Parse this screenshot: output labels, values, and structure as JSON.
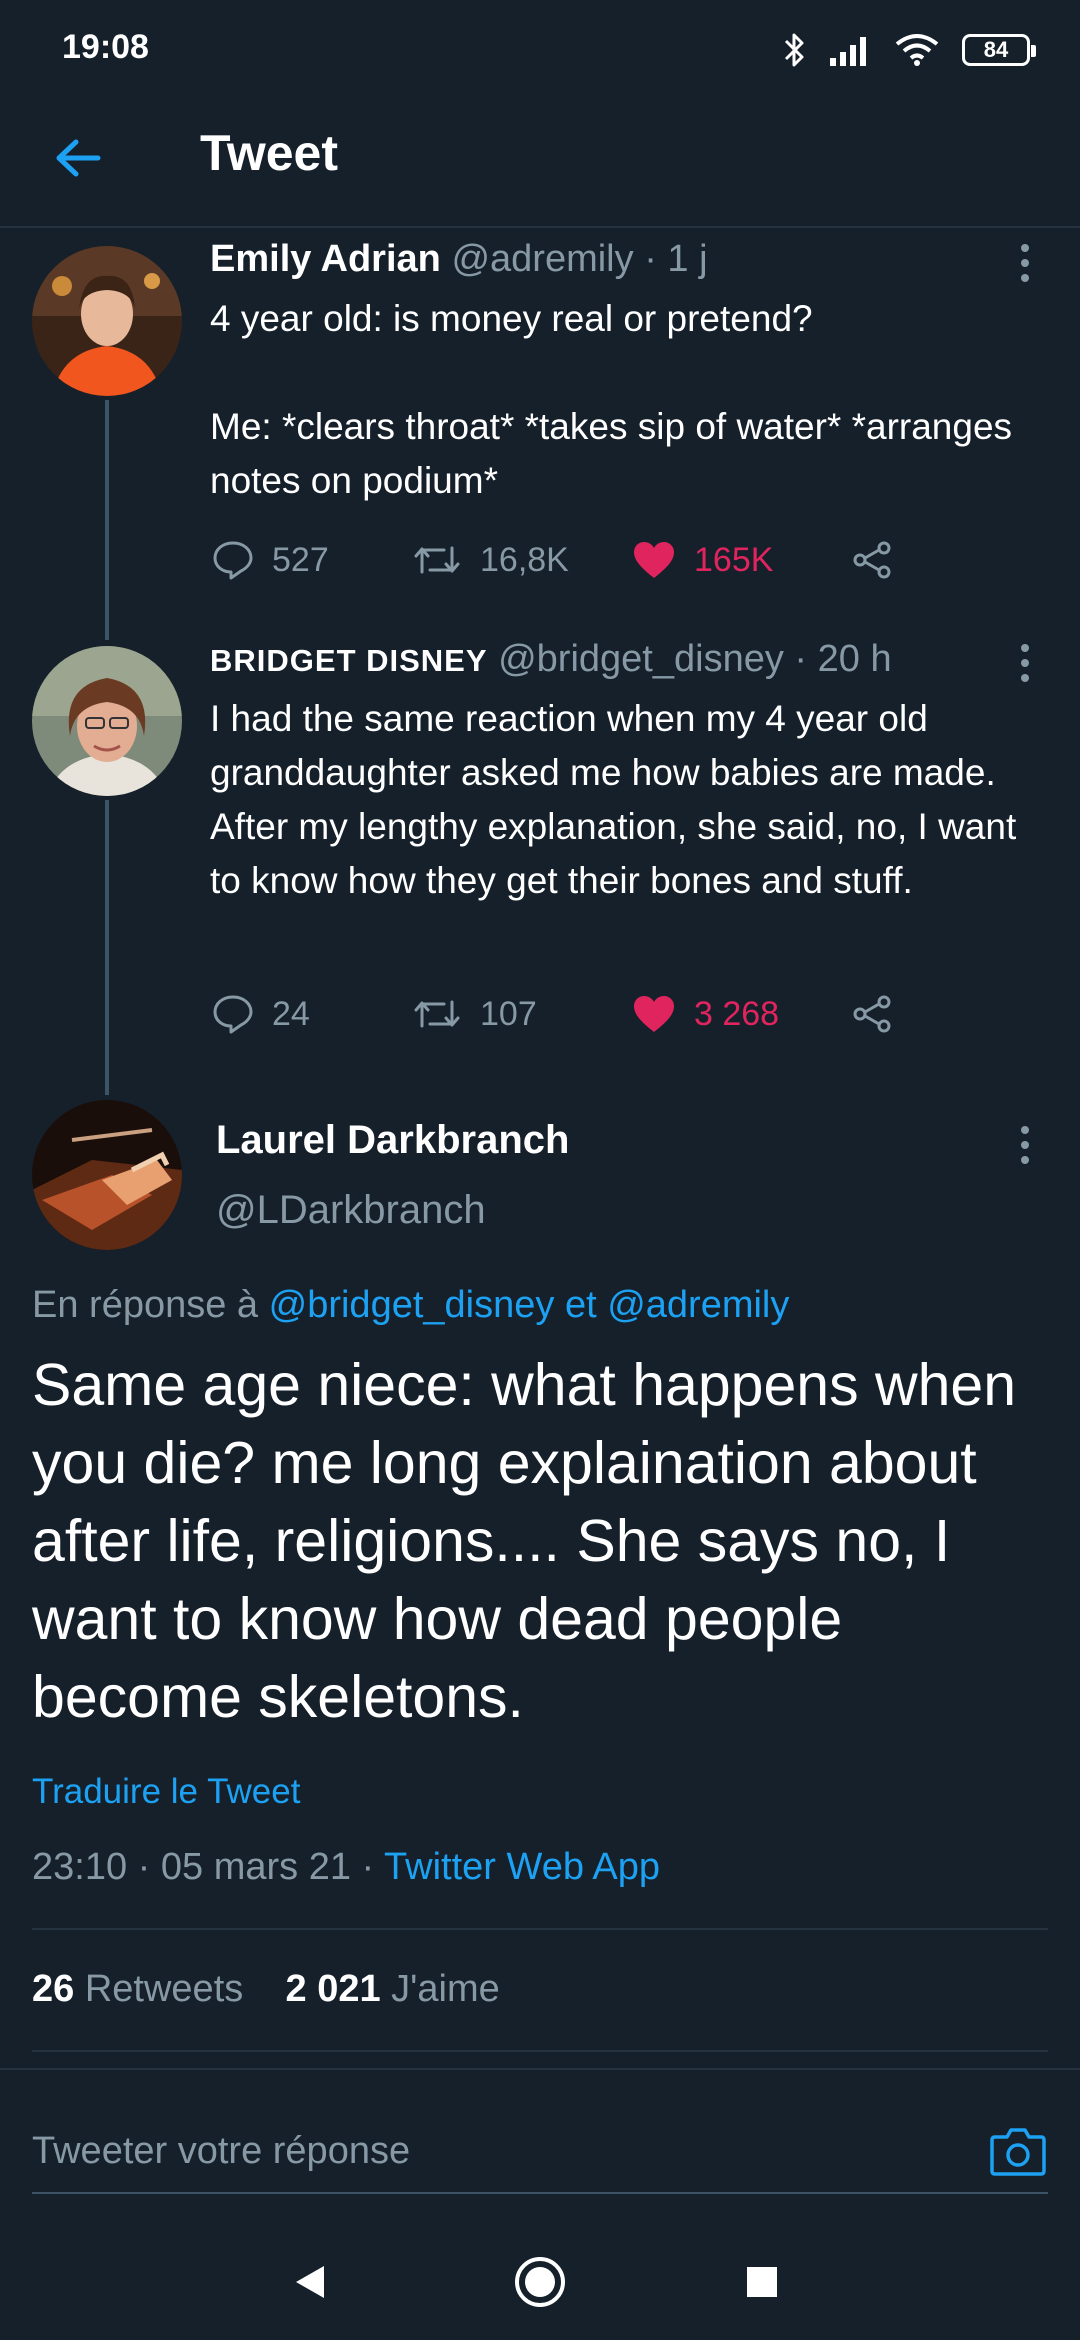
{
  "status_bar": {
    "time": "19:08",
    "battery": "84"
  },
  "header": {
    "title": "Tweet"
  },
  "tweets": [
    {
      "name": "Emily Adrian",
      "handle": "@adremily",
      "time": "· 1 j",
      "text": "4 year old: is money real or pretend?\n\nMe: *clears throat* *takes sip of water* *arranges notes on podium*",
      "replies": "527",
      "retweets": "16,8K",
      "likes": "165K"
    },
    {
      "name": "BRIDGET DISNEY",
      "handle": "@bridget_disney",
      "time": "· 20 h",
      "text": "I had the same reaction when my 4 year old granddaughter asked me how babies are made. After my lengthy explanation, she said, no, I want to know how they get their bones and stuff.",
      "replies": "24",
      "retweets": "107",
      "likes": "3 268"
    }
  ],
  "main_tweet": {
    "name": "Laurel Darkbranch",
    "handle": "@LDarkbranch",
    "reply_prefix": "En réponse à",
    "reply_user1": "@bridget_disney",
    "reply_and": "et",
    "reply_user2": "@adremily",
    "text": "Same age niece: what happens when you die? me long explaination about after life, religions.... She says no, I want to know how dead people become skeletons.",
    "translate": "Traduire le Tweet",
    "timestamp": "23:10 · 05 mars 21 ·",
    "source": "Twitter Web App",
    "retweet_count": "26",
    "retweet_label": "Retweets",
    "like_count": "2 021",
    "like_label": "J'aime"
  },
  "reply_bar": {
    "placeholder": "Tweeter votre réponse"
  },
  "icons": {
    "back": "arrow-left-icon",
    "more": "more-vertical-icon",
    "reply": "comment-icon",
    "retweet": "retweet-icon",
    "like": "heart-icon",
    "share": "share-icon",
    "camera": "camera-icon"
  },
  "colors": {
    "background": "#15202b",
    "accent": "#1da1f2",
    "like": "#e0245e",
    "muted": "#8899a6"
  }
}
